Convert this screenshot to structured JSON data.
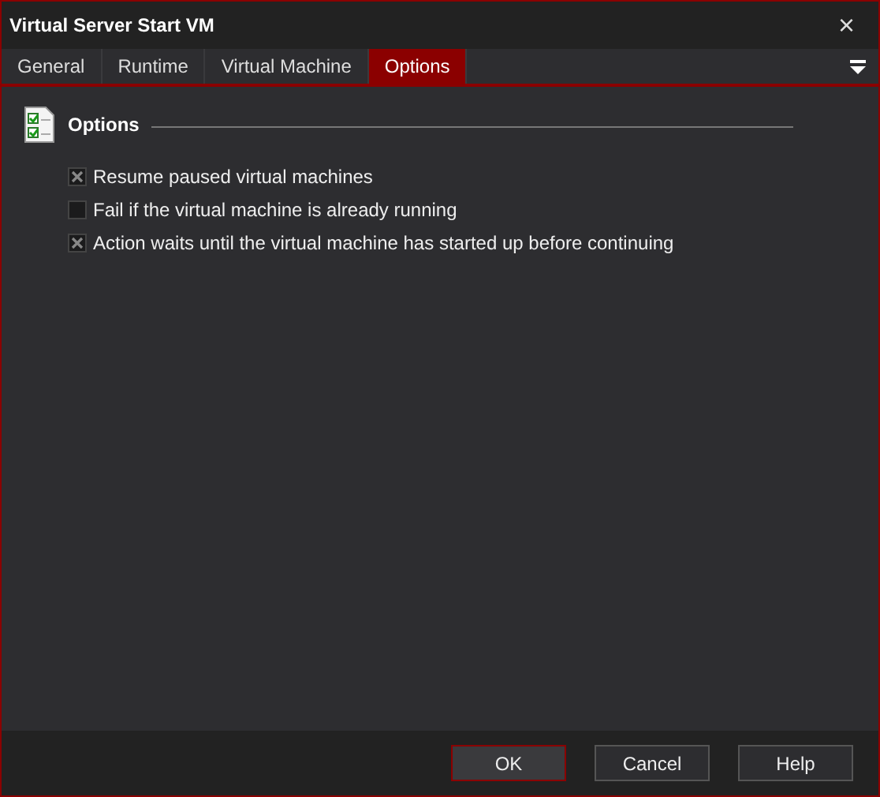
{
  "window": {
    "title": "Virtual Server Start VM",
    "close": "×"
  },
  "tabs": [
    {
      "label": "General",
      "selected": false
    },
    {
      "label": "Runtime",
      "selected": false
    },
    {
      "label": "Virtual Machine",
      "selected": false
    },
    {
      "label": "Options",
      "selected": true
    }
  ],
  "section": {
    "title": "Options"
  },
  "options": [
    {
      "label": "Resume paused virtual machines",
      "checked": true
    },
    {
      "label": "Fail if the virtual machine is already running",
      "checked": false
    },
    {
      "label": "Action waits until the virtual machine has started up before continuing",
      "checked": true
    }
  ],
  "buttons": [
    {
      "label": "OK",
      "default": true
    },
    {
      "label": "Cancel",
      "default": false
    },
    {
      "label": "Help",
      "default": false
    }
  ]
}
